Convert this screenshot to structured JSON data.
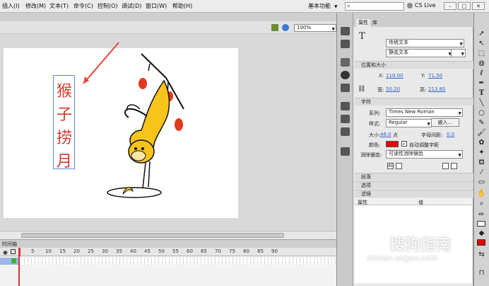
{
  "menu": {
    "items": [
      "插入(I)",
      "修改(M)",
      "文本(T)",
      "命令(C)",
      "控制(O)",
      "调试(D)",
      "窗口(W)",
      "帮助(H)"
    ],
    "workspace": "基本功能",
    "cs_live": "CS Live"
  },
  "stage": {
    "zoom": "100%",
    "text_chars": [
      "猴",
      "子",
      "捞",
      "月"
    ]
  },
  "timeline": {
    "frame_numbers": [
      "5",
      "10",
      "15",
      "20",
      "25",
      "30",
      "35",
      "40",
      "45",
      "50",
      "55",
      "60",
      "65",
      "70",
      "75",
      "80",
      "85",
      "90"
    ],
    "panel_label": "时间轴"
  },
  "props": {
    "tabs": [
      "属性",
      "库"
    ],
    "text_engine": "传统文本",
    "text_type": "静态文本",
    "position_section": "位置和大小",
    "x_label": "X:",
    "x_value": "119.00",
    "y_label": "Y:",
    "y_value": "71.50",
    "w_label": "宽:",
    "w_value": "50.20",
    "h_label": "高:",
    "h_value": "213.80",
    "char_section": "字符",
    "family_label": "系列:",
    "family_value": "Times New Roman",
    "style_label": "样式:",
    "style_value": "Regular",
    "embed_button": "嵌入...",
    "size_label": "大小:",
    "size_value": "46.0",
    "size_unit": "点",
    "spacing_label": "字母间距:",
    "spacing_value": "0.0",
    "color_label": "颜色:",
    "color_hex": "#e30000",
    "auto_kern": "自动调整字距",
    "aa_label": "消除锯齿:",
    "aa_value": "可读性消除锯齿",
    "section_para": "段落",
    "section_options": "选项",
    "section_filter": "滤镜",
    "filter_col_attr": "属性",
    "filter_col_value": "值"
  },
  "watermark": {
    "main": "搜狗指南",
    "url": "zhinan.sogou.com"
  }
}
